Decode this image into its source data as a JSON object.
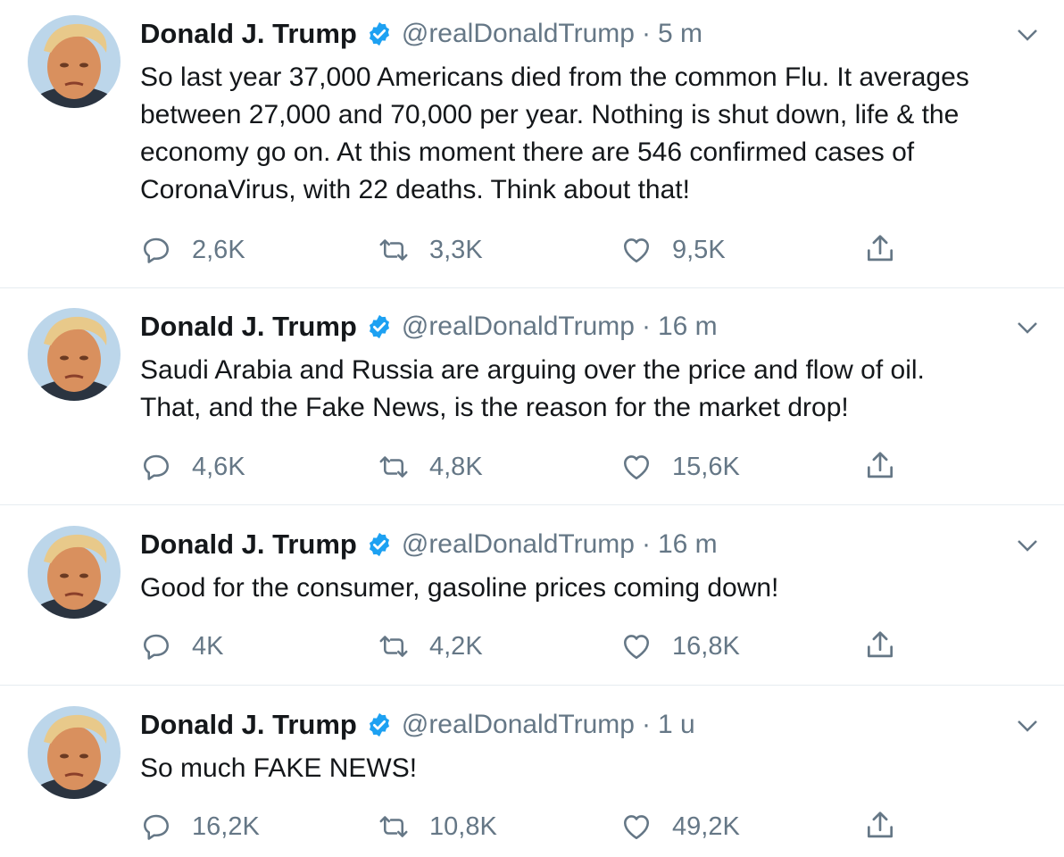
{
  "colors": {
    "text": "#14171a",
    "secondary": "#657786",
    "verified": "#1da1f2",
    "divider": "#e6ecf0"
  },
  "tweets": [
    {
      "name": "Donald J. Trump",
      "handle": "@realDonaldTrump",
      "separator": "·",
      "time": "5 m",
      "text": "So last year 37,000 Americans died from the common Flu. It averages\nbetween 27,000 and 70,000 per year. Nothing is shut down, life & the\neconomy go on. At this moment there are 546 confirmed cases of\nCoronaVirus, with 22 deaths. Think about that!",
      "replies": "2,6K",
      "retweets": "3,3K",
      "likes": "9,5K",
      "icons": [
        "reply-icon",
        "retweet-icon",
        "like-icon",
        "share-icon",
        "caret-down-icon",
        "verified-badge-icon"
      ]
    },
    {
      "name": "Donald J. Trump",
      "handle": "@realDonaldTrump",
      "separator": "·",
      "time": "16 m",
      "text": "Saudi Arabia and Russia are arguing over the price and flow of oil.\nThat, and the Fake News, is the reason for the market drop!",
      "replies": "4,6K",
      "retweets": "4,8K",
      "likes": "15,6K"
    },
    {
      "name": "Donald J. Trump",
      "handle": "@realDonaldTrump",
      "separator": "·",
      "time": "16 m",
      "text": "Good for the consumer, gasoline prices coming down!",
      "replies": "4K",
      "retweets": "4,2K",
      "likes": "16,8K"
    },
    {
      "name": "Donald J. Trump",
      "handle": "@realDonaldTrump",
      "separator": "·",
      "time": "1 u",
      "text": "So much FAKE NEWS!",
      "replies": "16,2K",
      "retweets": "10,8K",
      "likes": "49,2K"
    }
  ]
}
